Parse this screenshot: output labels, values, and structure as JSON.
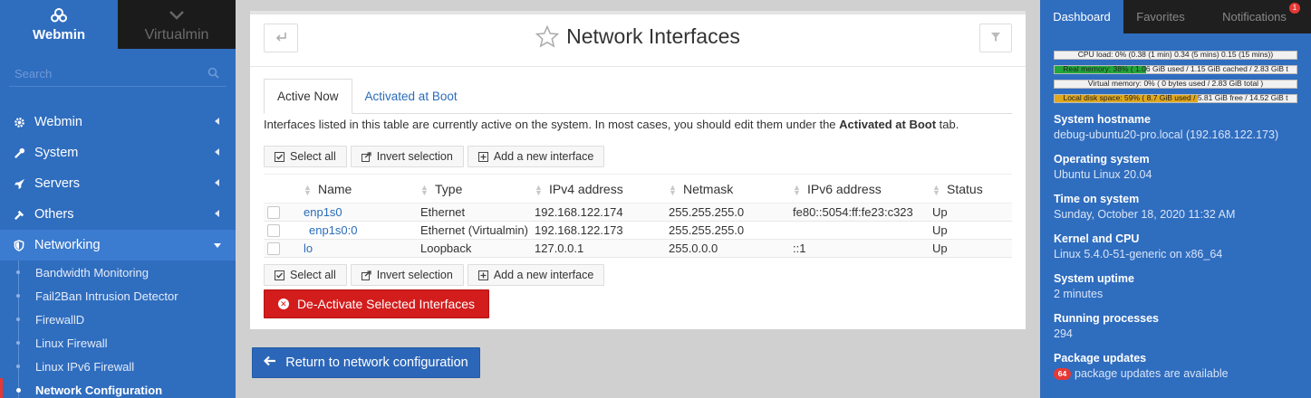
{
  "left": {
    "brand_webmin": "Webmin",
    "brand_virtualmin": "Virtualmin",
    "search_placeholder": "Search",
    "menu": [
      {
        "label": "Webmin",
        "icon": "gear-icon"
      },
      {
        "label": "System",
        "icon": "wrench-icon"
      },
      {
        "label": "Servers",
        "icon": "rocket-icon"
      },
      {
        "label": "Others",
        "icon": "wrench-icon"
      },
      {
        "label": "Networking",
        "icon": "shield-icon"
      }
    ],
    "submenu": [
      "Bandwidth Monitoring",
      "Fail2Ban Intrusion Detector",
      "FirewallD",
      "Linux Firewall",
      "Linux IPv6 Firewall",
      "Network Configuration"
    ]
  },
  "main": {
    "title": "Network Interfaces",
    "tabs": [
      "Active Now",
      "Activated at Boot"
    ],
    "desc_prefix": "Interfaces listed in this table are currently active on the system. In most cases, you should edit them under the ",
    "desc_bold": "Activated at Boot",
    "desc_suffix": " tab.",
    "buttons": {
      "select_all": "Select all",
      "invert": "Invert selection",
      "add": "Add a new interface"
    },
    "columns": [
      "Name",
      "Type",
      "IPv4 address",
      "Netmask",
      "IPv6 address",
      "Status"
    ],
    "rows": [
      {
        "name": "enp1s0",
        "type": "Ethernet",
        "ipv4": "192.168.122.174",
        "netmask": "255.255.255.0",
        "ipv6": "fe80::5054:ff:fe23:c323",
        "status": "Up"
      },
      {
        "name": "enp1s0:0",
        "type": "Ethernet (Virtualmin)",
        "ipv4": "192.168.122.173",
        "netmask": "255.255.255.0",
        "ipv6": "",
        "status": "Up"
      },
      {
        "name": "lo",
        "type": "Loopback",
        "ipv4": "127.0.0.1",
        "netmask": "255.0.0.0",
        "ipv6": "::1",
        "status": "Up"
      }
    ],
    "deactivate": "De-Activate Selected Interfaces",
    "return": "Return to network configuration"
  },
  "right": {
    "tabs": [
      "Dashboard",
      "Favorites",
      "Notifications"
    ],
    "notif_count": "1",
    "bars": [
      {
        "text": "CPU load: 0% (0.38 (1 min) 0.34 (5 mins) 0.15 (15 mins))",
        "percent": 0,
        "color": "#3aa64a"
      },
      {
        "text": "Real memory: 38% ( 1.06 GiB used / 1.15 GiB cached / 2.83 GiB t",
        "percent": 38,
        "color": "#22a63a"
      },
      {
        "text": "Virtual memory: 0% ( 0 bytes used / 2.83 GiB total )",
        "percent": 0,
        "color": "#22a63a"
      },
      {
        "text": "Local disk space: 59% ( 8.7 GiB used / 5.81 GiB free / 14.52 GiB t",
        "percent": 59,
        "color": "#e0a81c"
      }
    ],
    "info": [
      {
        "label": "System hostname",
        "value": "debug-ubuntu20-pro.local (192.168.122.173)"
      },
      {
        "label": "Operating system",
        "value": "Ubuntu Linux 20.04"
      },
      {
        "label": "Time on system",
        "value": "Sunday, October 18, 2020 11:32 AM"
      },
      {
        "label": "Kernel and CPU",
        "value": "Linux 5.4.0-51-generic on x86_64"
      },
      {
        "label": "System uptime",
        "value": "2 minutes"
      },
      {
        "label": "Running processes",
        "value": "294"
      }
    ],
    "pkg_label": "Package updates",
    "pkg_count": "64",
    "pkg_text": "package updates are available"
  }
}
